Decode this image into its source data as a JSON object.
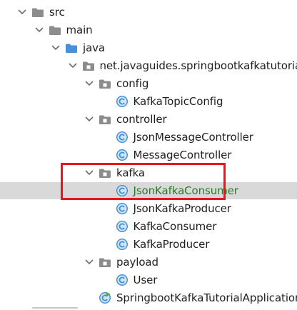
{
  "tree": [
    {
      "label": "src",
      "type": "folder",
      "depth": 0,
      "expanded": true,
      "folder_color": "#8c8c8c"
    },
    {
      "label": "main",
      "type": "folder",
      "depth": 1,
      "expanded": true,
      "folder_color": "#8c8c8c"
    },
    {
      "label": "java",
      "type": "folder",
      "depth": 2,
      "expanded": true,
      "folder_color": "#4a90d9"
    },
    {
      "label": "net.javaguides.springbootkafkatutorial",
      "type": "package",
      "depth": 3,
      "expanded": true
    },
    {
      "label": "config",
      "type": "package",
      "depth": 4,
      "expanded": true
    },
    {
      "label": "KafkaTopicConfig",
      "type": "class",
      "depth": 5
    },
    {
      "label": "controller",
      "type": "package",
      "depth": 4,
      "expanded": true
    },
    {
      "label": "JsonMessageController",
      "type": "class",
      "depth": 5
    },
    {
      "label": "MessageController",
      "type": "class",
      "depth": 5
    },
    {
      "label": "kafka",
      "type": "package",
      "depth": 4,
      "expanded": true
    },
    {
      "label": "JsonKafkaConsumer",
      "type": "class",
      "depth": 5,
      "selected": true
    },
    {
      "label": "JsonKafkaProducer",
      "type": "class",
      "depth": 5
    },
    {
      "label": "KafkaConsumer",
      "type": "class",
      "depth": 5
    },
    {
      "label": "KafkaProducer",
      "type": "class",
      "depth": 5
    },
    {
      "label": "payload",
      "type": "package",
      "depth": 4,
      "expanded": true
    },
    {
      "label": "User",
      "type": "class",
      "depth": 5
    },
    {
      "label": "SpringbootKafkaTutorialApplication",
      "type": "app-class",
      "depth": 4
    }
  ],
  "colors": {
    "class_icon_fill": "#cfe4f7",
    "class_icon_stroke": "#3d8ed6",
    "package_icon": "#8c8c8c",
    "selected_row_bg": "#d9d9d9",
    "selected_text": "#237d23",
    "highlight_border": "#e8161b",
    "run_badge": "#4caf50"
  }
}
